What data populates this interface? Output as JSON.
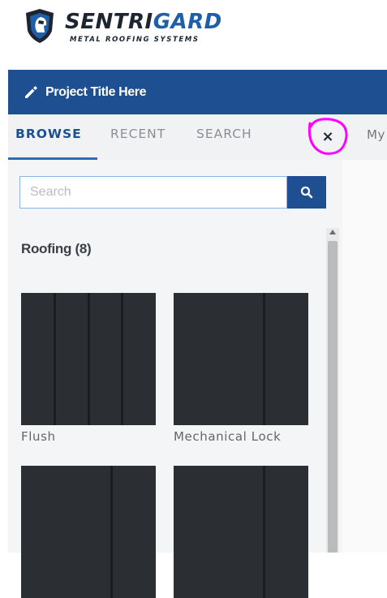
{
  "brand": {
    "name_part1": "SENTRI",
    "name_part2": "GARD",
    "tagline": "METAL ROOFING SYSTEMS"
  },
  "header": {
    "project_title": "Project Title Here"
  },
  "tabs": {
    "items": [
      {
        "label": "BROWSE",
        "active": true
      },
      {
        "label": "RECENT",
        "active": false
      },
      {
        "label": "SEARCH",
        "active": false
      }
    ],
    "close_label": "×",
    "overflow_label": "My"
  },
  "search": {
    "placeholder": "Search",
    "value": ""
  },
  "category": {
    "heading": "Roofing (8)"
  },
  "products": [
    {
      "label": "Flush"
    },
    {
      "label": "Mechanical Lock"
    },
    {
      "label": ""
    },
    {
      "label": ""
    }
  ],
  "colors": {
    "brand_blue": "#1d4f91",
    "highlight_ring": "#ff00ff",
    "tile_dark": "#2b2f33"
  },
  "icons": {
    "pencil": "pencil-icon",
    "search": "search-icon",
    "close": "close-icon",
    "logo": "shield-helmet-icon"
  }
}
